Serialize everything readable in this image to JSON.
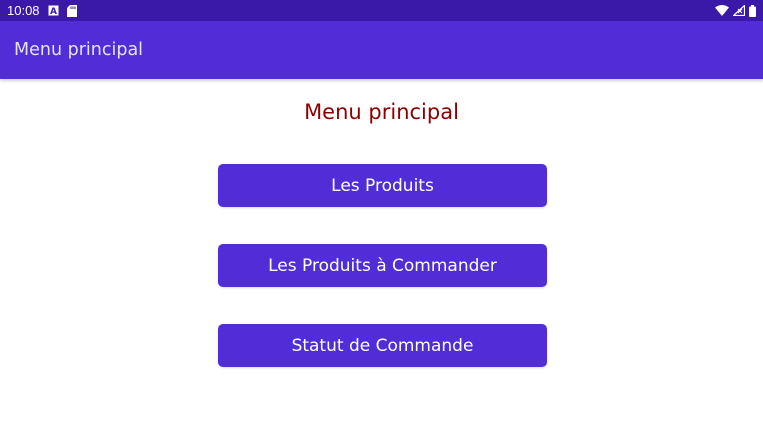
{
  "status_bar": {
    "time": "10:08",
    "icons": [
      "notification-a-icon",
      "sd-card-icon",
      "wifi-icon",
      "signal-icon",
      "battery-icon"
    ]
  },
  "app_bar": {
    "title": "Menu principal"
  },
  "main": {
    "title": "Menu principal",
    "buttons": [
      {
        "label": "Les Produits"
      },
      {
        "label": "Les Produits à Commander"
      },
      {
        "label": "Statut de Commande"
      }
    ]
  },
  "colors": {
    "status_bar": "#3b19a8",
    "primary": "#512dd8",
    "title_text": "#8b0000",
    "button_text": "#ffffff"
  }
}
